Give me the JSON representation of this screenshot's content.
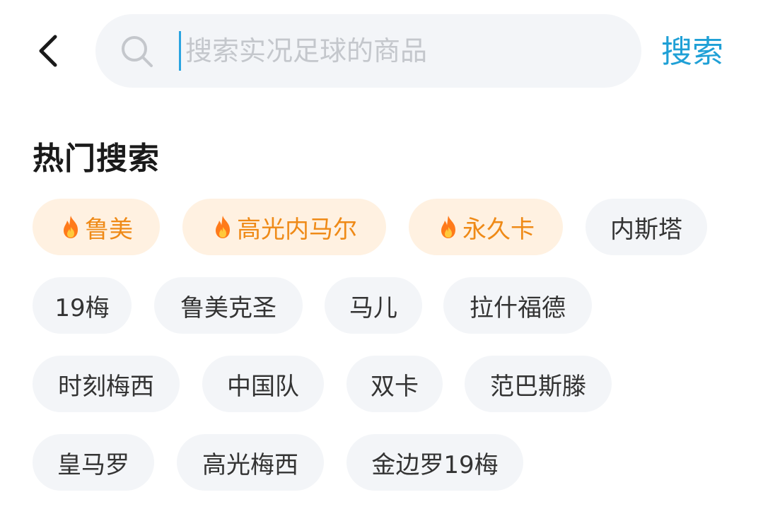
{
  "header": {
    "back_label": "",
    "search_placeholder": "搜索实况足球的商品",
    "search_value": "",
    "search_button": "搜索"
  },
  "hot_section": {
    "title": "热门搜索",
    "tags": [
      {
        "label": "鲁美",
        "hot": true
      },
      {
        "label": "高光内马尔",
        "hot": true
      },
      {
        "label": "永久卡",
        "hot": true
      },
      {
        "label": "内斯塔",
        "hot": false
      },
      {
        "label": "19梅",
        "hot": false
      },
      {
        "label": "鲁美克圣",
        "hot": false
      },
      {
        "label": "马儿",
        "hot": false
      },
      {
        "label": "拉什福德",
        "hot": false
      },
      {
        "label": "时刻梅西",
        "hot": false
      },
      {
        "label": "中国队",
        "hot": false
      },
      {
        "label": "双卡",
        "hot": false
      },
      {
        "label": "范巴斯滕",
        "hot": false
      },
      {
        "label": "皇马罗",
        "hot": false
      },
      {
        "label": "高光梅西",
        "hot": false
      },
      {
        "label": "金边罗19梅",
        "hot": false
      }
    ]
  },
  "icons": {
    "back": "chevron-left-icon",
    "search": "search-icon",
    "hot": "fire-icon"
  },
  "colors": {
    "accent": "#1fa0d6",
    "hot_text": "#ef8a17",
    "hot_bg": "#fff1e1",
    "tag_bg": "#f3f5f8"
  }
}
